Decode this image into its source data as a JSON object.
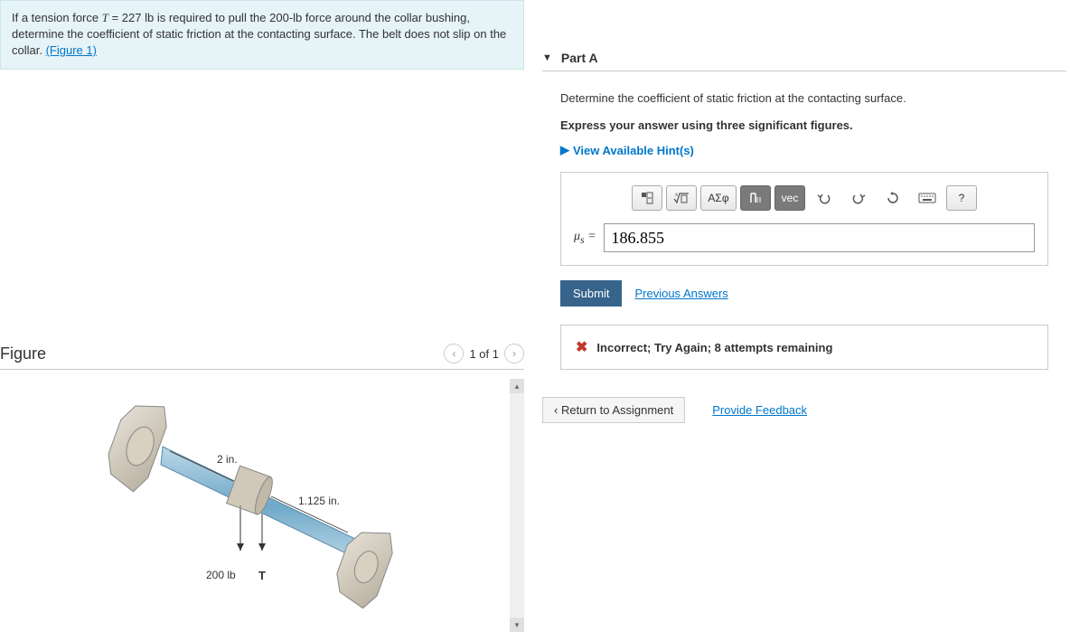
{
  "problem": {
    "text_prefix": "If a tension force ",
    "var_T": "T",
    "eq": " = 227 ",
    "unit_lb": "lb",
    "text_mid": " is required to pull the 200-",
    "unit_lb2": "lb",
    "text_mid2": " force around the collar bushing, determine the coefficient of static friction at the contacting surface. The belt does not slip on the collar. ",
    "figure_link": "(Figure 1)"
  },
  "figure": {
    "title": "Figure",
    "nav_label": "1 of 1",
    "labels": {
      "dim1": "2 in.",
      "dim2": "1.125 in.",
      "force": "200 lb",
      "tension": "T"
    }
  },
  "partA": {
    "title": "Part A",
    "instruction1": "Determine the coefficient of static friction at the contacting surface.",
    "instruction2": "Express your answer using three significant figures.",
    "hints_label": "View Available Hint(s)",
    "toolbar": {
      "templates": "ΑΣφ",
      "vec": "vec",
      "help": "?"
    },
    "answer": {
      "symbol": "μ",
      "subscript": "s",
      "equals": " = ",
      "value": "186.855"
    },
    "submit_label": "Submit",
    "prev_answers_label": "Previous Answers",
    "feedback": "Incorrect; Try Again; 8 attempts remaining"
  },
  "footer": {
    "return_label": "Return to Assignment",
    "feedback_link": "Provide Feedback"
  }
}
